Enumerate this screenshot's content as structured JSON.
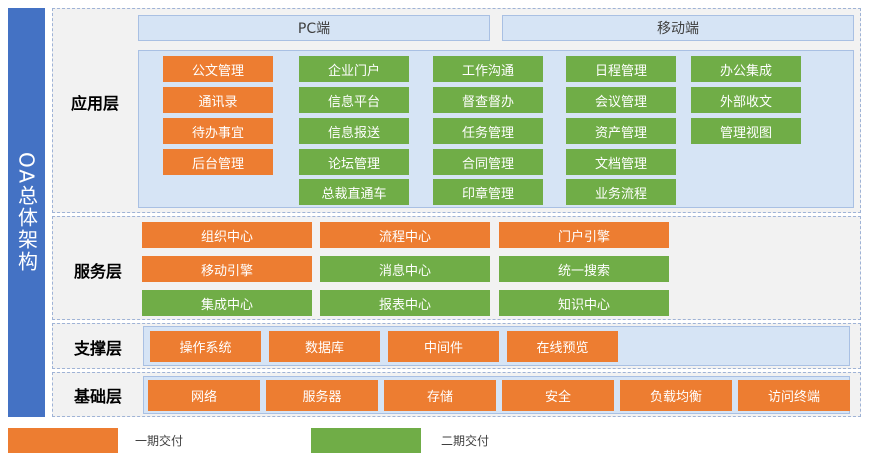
{
  "sidebar": {
    "title": "OA总体架构"
  },
  "header": {
    "pc": "PC端",
    "mobile": "移动端"
  },
  "layers": {
    "application": "应用层",
    "service": "服务层",
    "support": "支撑层",
    "foundation": "基础层"
  },
  "application_boxes": [
    [
      "公文管理",
      "通讯录",
      "待办事宜",
      "后台管理"
    ],
    [
      "企业门户",
      "信息平台",
      "信息报送",
      "论坛管理",
      "总裁直通车"
    ],
    [
      "工作沟通",
      "督查督办",
      "任务管理",
      "合同管理",
      "印章管理"
    ],
    [
      "日程管理",
      "会议管理",
      "资产管理",
      "文档管理",
      "业务流程"
    ],
    [
      "办公集成",
      "外部收文",
      "管理视图"
    ]
  ],
  "service_boxes": [
    [
      "组织中心",
      "流程中心",
      "门户引擎"
    ],
    [
      "移动引擎",
      "消息中心",
      "统一搜索"
    ],
    [
      "集成中心",
      "报表中心",
      "知识中心"
    ]
  ],
  "support_boxes": [
    "操作系统",
    "数据库",
    "中间件",
    "在线预览"
  ],
  "foundation_boxes": [
    "网络",
    "服务器",
    "存储",
    "安全",
    "负载均衡",
    "访问终端"
  ],
  "legend": {
    "phase1": "一期交付",
    "phase2": "二期交付"
  },
  "colors": {
    "phase1": "#ed7d31",
    "phase2": "#70ad47",
    "sidebar": "#4472c4"
  }
}
